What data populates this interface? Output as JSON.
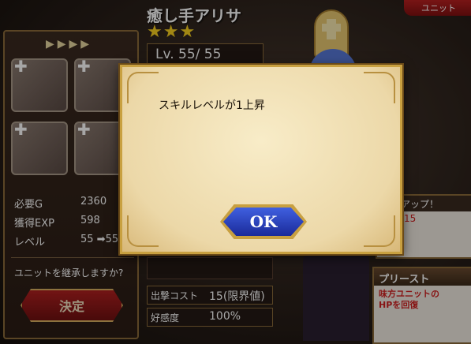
{
  "header": {
    "unit_name": "癒し手アリサ",
    "stars": "★★★",
    "level": "Lv. 55/ 55",
    "tab_label": "ユニット"
  },
  "left_panel": {
    "arrows": "▶▶▶▶",
    "stats": [
      {
        "label": "必要G",
        "value": "2360"
      },
      {
        "label": "獲得EXP",
        "value": "598"
      },
      {
        "label": "レベル",
        "value": "55 ➡55"
      }
    ],
    "inherit_question": "ユニットを継承しますか?",
    "decide_label": "決定"
  },
  "right": {
    "up_header": "アップ！",
    "up_value": "15",
    "priest_header": "プリースト",
    "priest_desc": "味方ユニットの HPを回復"
  },
  "info": {
    "cost_label": "出撃コスト",
    "cost_value": "15(限界値)",
    "affection_label": "好感度",
    "affection_value": "100%"
  },
  "dialog": {
    "message": "スキルレベルが1上昇",
    "ok_label": "OK"
  },
  "colors": {
    "ok_button": "#2a40c0",
    "decide_button": "#a01818",
    "highlight_red": "#d02020"
  }
}
